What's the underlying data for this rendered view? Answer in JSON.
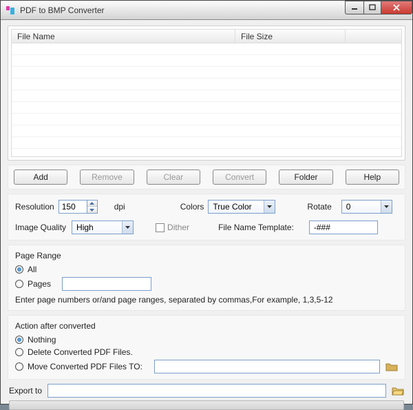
{
  "window": {
    "title": "PDF to BMP Converter"
  },
  "list": {
    "col_filename": "File Name",
    "col_filesize": "File Size"
  },
  "buttons": {
    "add": "Add",
    "remove": "Remove",
    "clear": "Clear",
    "convert": "Convert",
    "folder": "Folder",
    "help": "Help"
  },
  "settings": {
    "resolution_label": "Resolution",
    "resolution_value": "150",
    "dpi_label": "dpi",
    "colors_label": "Colors",
    "colors_value": "True Color",
    "rotate_label": "Rotate",
    "rotate_value": "0",
    "image_quality_label": "Image Quality",
    "image_quality_value": "High",
    "dither_label": "Dither",
    "filename_template_label": "File Name Template:",
    "filename_template_value": "-###"
  },
  "page_range": {
    "group_label": "Page Range",
    "all_label": "All",
    "pages_label": "Pages",
    "pages_value": "",
    "hint": "Enter page numbers or/and page ranges, separated by commas,For example, 1,3,5-12"
  },
  "action": {
    "group_label": "Action after converted",
    "nothing_label": "Nothing",
    "delete_label": "Delete Converted PDF Files.",
    "move_label": "Move Converted PDF Files TO:",
    "move_path": ""
  },
  "export": {
    "label": "Export to",
    "value": ""
  }
}
